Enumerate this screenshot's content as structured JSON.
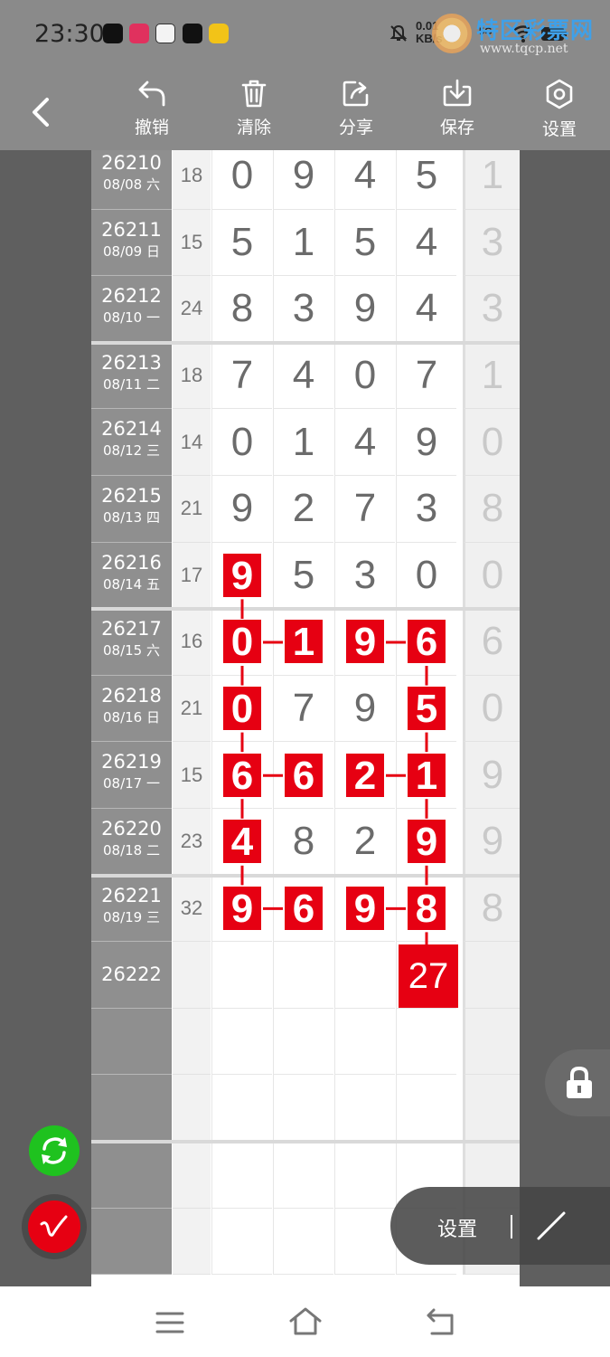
{
  "status_bar": {
    "time": "23:30",
    "net_speed_top": "0.01",
    "net_speed_bottom": "KB/s",
    "signal_label": "5G"
  },
  "watermark": {
    "title": "特区彩票网",
    "url": "www.tqcp.net"
  },
  "toolbar": {
    "back_icon": "chevron-left-icon",
    "items": [
      {
        "label": "撤销",
        "icon": "undo-icon"
      },
      {
        "label": "清除",
        "icon": "trash-icon"
      },
      {
        "label": "分享",
        "icon": "share-icon"
      },
      {
        "label": "保存",
        "icon": "download-icon"
      },
      {
        "label": "设置",
        "icon": "hexagon-settings-icon"
      }
    ]
  },
  "table": {
    "rows": [
      {
        "issue": "26210",
        "date": "08/08 六",
        "sum": "18",
        "digits": [
          "0",
          "9",
          "4",
          "5"
        ],
        "last": "1"
      },
      {
        "issue": "26211",
        "date": "08/09 日",
        "sum": "15",
        "digits": [
          "5",
          "1",
          "5",
          "4"
        ],
        "last": "3"
      },
      {
        "issue": "26212",
        "date": "08/10 一",
        "sum": "24",
        "digits": [
          "8",
          "3",
          "9",
          "4"
        ],
        "last": "3"
      },
      {
        "issue": "26213",
        "date": "08/11 二",
        "sum": "18",
        "digits": [
          "7",
          "4",
          "0",
          "7"
        ],
        "last": "1"
      },
      {
        "issue": "26214",
        "date": "08/12 三",
        "sum": "14",
        "digits": [
          "0",
          "1",
          "4",
          "9"
        ],
        "last": "0"
      },
      {
        "issue": "26215",
        "date": "08/13 四",
        "sum": "21",
        "digits": [
          "9",
          "2",
          "7",
          "3"
        ],
        "last": "8"
      },
      {
        "issue": "26216",
        "date": "08/14 五",
        "sum": "17",
        "digits": [
          "9",
          "5",
          "3",
          "0"
        ],
        "last": "0"
      },
      {
        "issue": "26217",
        "date": "08/15 六",
        "sum": "16",
        "digits": [
          "0",
          "1",
          "9",
          "6"
        ],
        "last": "6"
      },
      {
        "issue": "26218",
        "date": "08/16 日",
        "sum": "21",
        "digits": [
          "0",
          "7",
          "9",
          "5"
        ],
        "last": "0"
      },
      {
        "issue": "26219",
        "date": "08/17 一",
        "sum": "15",
        "digits": [
          "6",
          "6",
          "2",
          "1"
        ],
        "last": "9"
      },
      {
        "issue": "26220",
        "date": "08/18 二",
        "sum": "23",
        "digits": [
          "4",
          "8",
          "2",
          "9"
        ],
        "last": "9"
      },
      {
        "issue": "26221",
        "date": "08/19 三",
        "sum": "32",
        "digits": [
          "9",
          "6",
          "9",
          "8"
        ],
        "last": "8"
      },
      {
        "issue": "26222",
        "date": "",
        "sum": "",
        "digits": [
          "",
          "",
          "",
          ""
        ],
        "last": ""
      }
    ],
    "highlights": [
      {
        "row": 6,
        "col": 0
      },
      {
        "row": 7,
        "col": 0
      },
      {
        "row": 7,
        "col": 1
      },
      {
        "row": 7,
        "col": 2
      },
      {
        "row": 7,
        "col": 3
      },
      {
        "row": 8,
        "col": 0
      },
      {
        "row": 8,
        "col": 3
      },
      {
        "row": 9,
        "col": 0
      },
      {
        "row": 9,
        "col": 1
      },
      {
        "row": 9,
        "col": 2
      },
      {
        "row": 9,
        "col": 3
      },
      {
        "row": 10,
        "col": 0
      },
      {
        "row": 10,
        "col": 3
      },
      {
        "row": 11,
        "col": 0
      },
      {
        "row": 11,
        "col": 1
      },
      {
        "row": 11,
        "col": 2
      },
      {
        "row": 11,
        "col": 3
      }
    ],
    "prediction": "27"
  },
  "floating": {
    "lock_icon": "lock-icon",
    "refresh_icon": "refresh-icon",
    "pen_icon": "pen-icon",
    "settings_label": "设置",
    "line_tool_icon": "diagonal-line-icon"
  },
  "navbar": {
    "menu_icon": "menu-icon",
    "home_icon": "home-icon",
    "back_icon": "back-icon"
  },
  "colors": {
    "highlight": "#e60012",
    "issue_column": "#8f8f8f",
    "toolbar": "#8a8a8a",
    "refresh": "#1fc21f"
  }
}
